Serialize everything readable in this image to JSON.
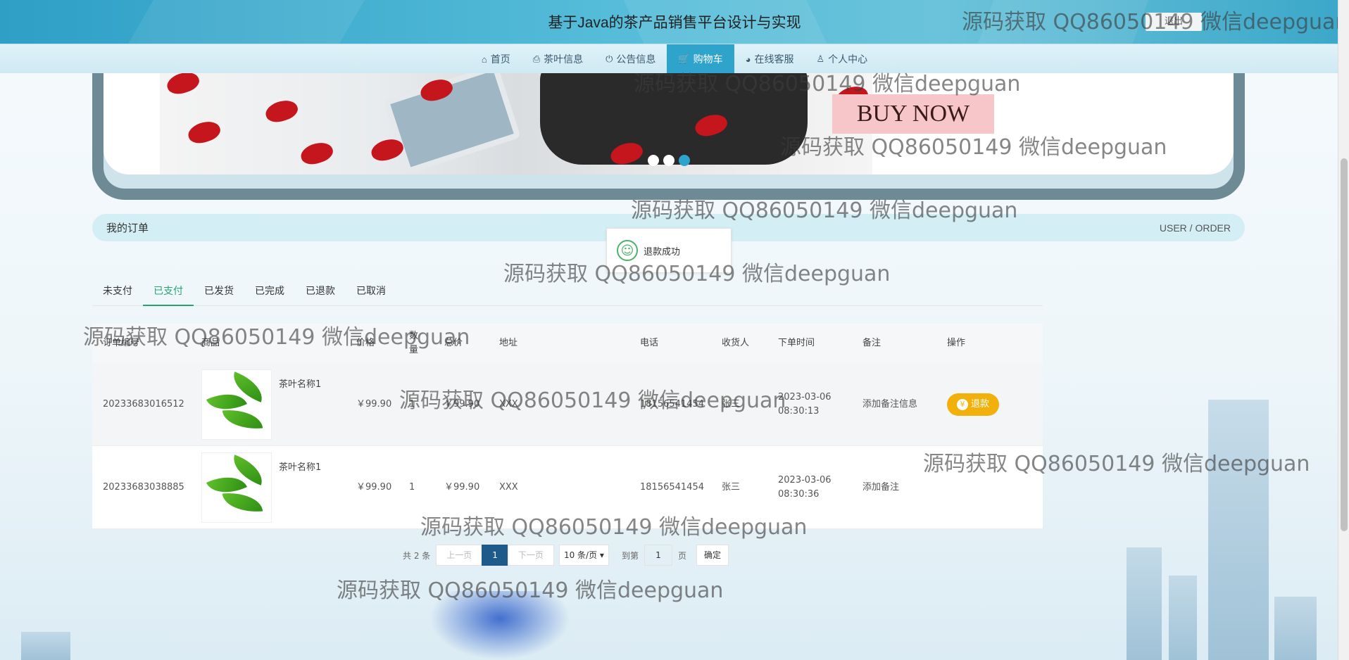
{
  "header": {
    "title": "基于Java的茶产品销售平台设计与实现",
    "logout_label": "退出"
  },
  "nav": {
    "items": [
      {
        "label": "首页",
        "icon": "home-icon"
      },
      {
        "label": "茶叶信息",
        "icon": "printer-icon"
      },
      {
        "label": "公告信息",
        "icon": "power-icon"
      },
      {
        "label": "购物车",
        "icon": "cart-icon",
        "active": true
      },
      {
        "label": "在线客服",
        "icon": "chat-icon"
      },
      {
        "label": "个人中心",
        "icon": "user-icon"
      }
    ]
  },
  "banner": {
    "cta": "BUY NOW",
    "slides": 3,
    "active_slide": 3
  },
  "section": {
    "title": "我的订单",
    "subtitle": "USER / ORDER"
  },
  "toast": {
    "message": "退款成功"
  },
  "tabs": [
    {
      "label": "未支付"
    },
    {
      "label": "已支付",
      "active": true
    },
    {
      "label": "已发货"
    },
    {
      "label": "已完成"
    },
    {
      "label": "已退款"
    },
    {
      "label": "已取消"
    }
  ],
  "table": {
    "headers": [
      "订单编号",
      "商品",
      "价格",
      "数量",
      "总价",
      "地址",
      "电话",
      "收货人",
      "下单时间",
      "备注",
      "操作"
    ],
    "rows": [
      {
        "order_no": "20233683016512",
        "goods_name": "茶叶名称1",
        "price": "￥99.90",
        "qty": "1",
        "total": "￥99.90",
        "address": "XXX",
        "phone": "18156541454",
        "receiver": "张三",
        "time": "2023-03-06 08:30:13",
        "note": "添加备注信息",
        "action": "退款"
      },
      {
        "order_no": "20233683038885",
        "goods_name": "茶叶名称1",
        "price": "￥99.90",
        "qty": "1",
        "total": "￥99.90",
        "address": "XXX",
        "phone": "18156541454",
        "receiver": "张三",
        "time": "2023-03-06 08:30:36",
        "note": "添加备注",
        "action": ""
      }
    ]
  },
  "pagination": {
    "total": "共 2 条",
    "prev": "上一页",
    "current": "1",
    "next": "下一页",
    "page_size": "10 条/页",
    "goto_label": "到第",
    "goto_value": "1",
    "page_unit": "页",
    "confirm": "确定"
  },
  "watermark": "源码获取 QQ86050149 微信deepguan",
  "colors": {
    "accent": "#2ea3cc",
    "tab_active": "#28a36e",
    "refund": "#f2b10a",
    "pager_current": "#1e5b8a"
  }
}
